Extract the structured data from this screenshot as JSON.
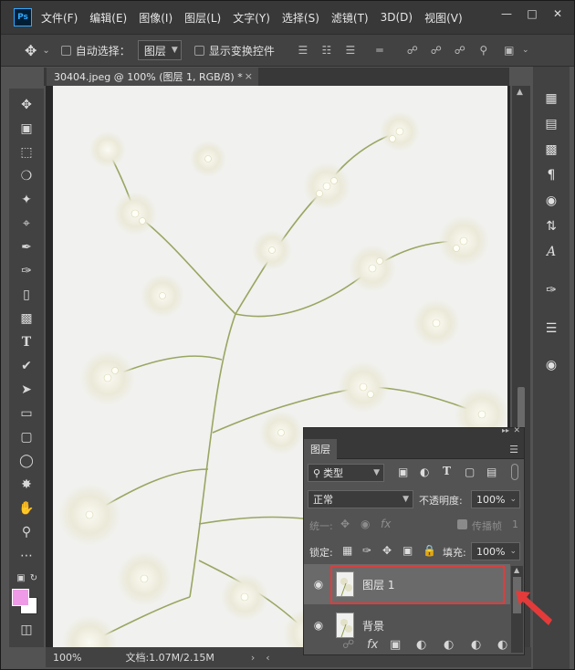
{
  "menubar": {
    "logo": "Ps",
    "items": [
      "文件(F)",
      "编辑(E)",
      "图像(I)",
      "图层(L)",
      "文字(Y)",
      "选择(S)",
      "滤镜(T)",
      "3D(D)",
      "视图(V)"
    ]
  },
  "options": {
    "auto_select_label": "自动选择：",
    "auto_select_value": "图层",
    "show_transform_label": "显示变换控件"
  },
  "document": {
    "tab_title": "30404.jpeg @ 100% (图层 1, RGB/8) *",
    "close": "×"
  },
  "status": {
    "zoom": "100%",
    "doc_size": "文档:1.07M/2.15M"
  },
  "colors": {
    "foreground": "#ee9ae6",
    "background": "#ffffff",
    "highlight": "#e53a3a"
  },
  "layers_panel": {
    "tab": "图层",
    "filter_kind": "类型",
    "blend_mode": "正常",
    "opacity_label": "不透明度:",
    "opacity_value": "100%",
    "unify_label": "统一:",
    "propagate_label": "传播帧",
    "propagate_value": "1",
    "lock_label": "锁定:",
    "fill_label": "填充:",
    "fill_value": "100%",
    "layers": [
      {
        "name": "图层 1",
        "selected": true
      },
      {
        "name": "背景",
        "selected": false
      }
    ]
  }
}
